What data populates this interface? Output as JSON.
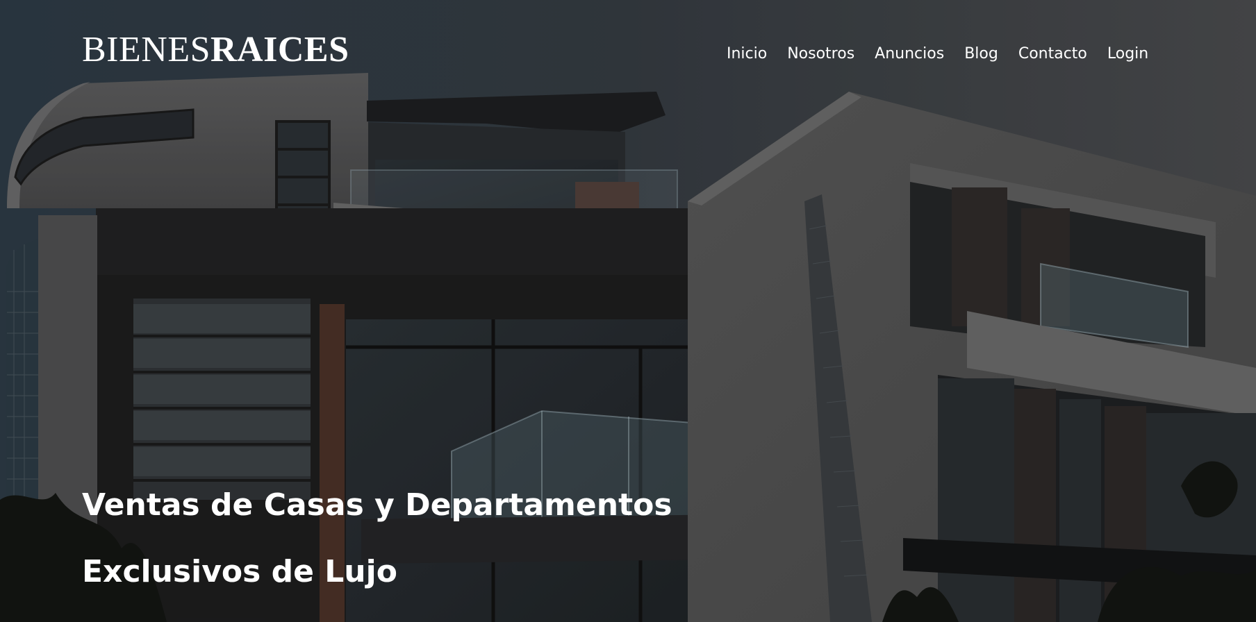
{
  "header": {
    "logo_light": "BIENES",
    "logo_bold": "RAICES",
    "nav": [
      "Inicio",
      "Nosotros",
      "Anuncios",
      "Blog",
      "Contacto",
      "Login"
    ]
  },
  "hero": {
    "headline_line1": "Ventas de Casas y Departamentos",
    "headline_line2": "Exclusivos de Lujo"
  }
}
